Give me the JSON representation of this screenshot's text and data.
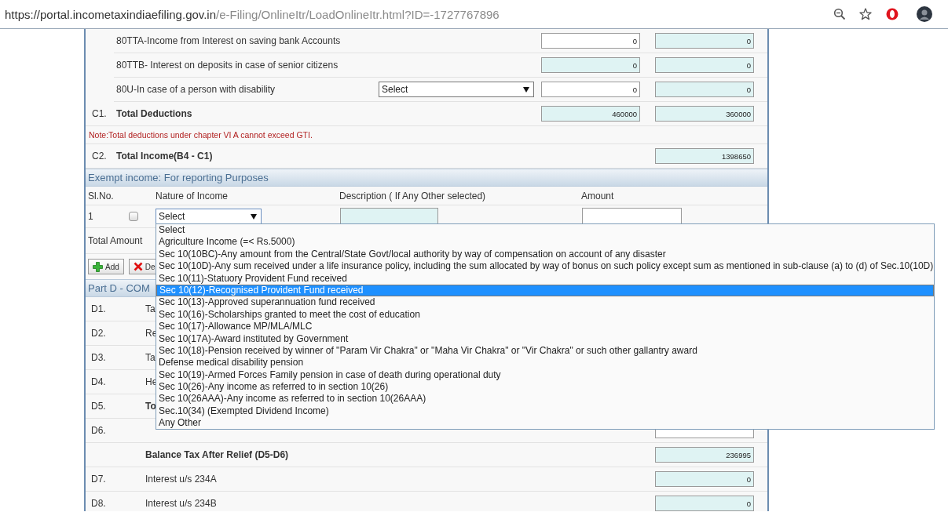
{
  "browser": {
    "url_host": "https://portal.incometaxindiaefiling.gov.in",
    "url_path": "/e-Filing/OnlineItr/LoadOnlineItr.html?ID=-1727767896"
  },
  "deductions": [
    {
      "kind": "item",
      "label": "80TTA-Income from Interest on saving bank Accounts",
      "fields": [
        {
          "value": "0",
          "editable": true
        },
        {
          "value": "0",
          "editable": false
        }
      ]
    },
    {
      "kind": "item",
      "label": "80TTB- Interest on deposits in case of senior citizens",
      "fields": [
        {
          "value": "0",
          "editable": false
        },
        {
          "value": "0",
          "editable": false
        }
      ]
    },
    {
      "kind": "item",
      "label": "80U-In case of a person with disability",
      "select": "Select",
      "fields": [
        {
          "value": "0",
          "editable": true
        },
        {
          "value": "0",
          "editable": false
        }
      ]
    },
    {
      "kind": "total",
      "code": "C1.",
      "label": "Total Deductions",
      "fields": [
        {
          "value": "460000",
          "editable": false
        },
        {
          "value": "360000",
          "editable": false
        }
      ]
    },
    {
      "kind": "note",
      "text": "Note:Total deductions under chapter VI A cannot exceed GTI."
    },
    {
      "kind": "total",
      "code": "C2.",
      "label": "Total Income(B4 - C1)",
      "fields": [
        {
          "value": "1398650",
          "editable": false
        }
      ]
    }
  ],
  "exempt": {
    "title": "Exempt income: For reporting Purposes",
    "columns": [
      "Sl.No.",
      "Nature of Income",
      "Description ( If Any Other selected)",
      "Amount"
    ],
    "rows": [
      {
        "sl": "1",
        "checked": false,
        "nature": "Select"
      }
    ],
    "total_label": "Total Amount",
    "buttons": [
      {
        "label": "Add",
        "kind": "add"
      },
      {
        "label": "De",
        "kind": "delete"
      }
    ],
    "dropdown": [
      {
        "label": "Select",
        "selected": false
      },
      {
        "label": "Agriculture Income (=< Rs.5000)",
        "selected": false
      },
      {
        "label": "Sec 10(10BC)-Any amount from the Central/State Govt/local authority by way of compensation on account of any disaster",
        "selected": false
      },
      {
        "label": "Sec 10(10D)-Any sum received under a life insurance policy, including the sum allocated by way of bonus on such policy except sum as mentioned in sub-clause (a) to (d) of Sec.10(10D)",
        "selected": false
      },
      {
        "label": "Sec 10(11)-Statuory Provident Fund received",
        "selected": false
      },
      {
        "label": "Sec 10(12)-Recognised Provident Fund received",
        "selected": true
      },
      {
        "label": "Sec 10(13)-Approved superannuation fund received",
        "selected": false
      },
      {
        "label": "Sec 10(16)-Scholarships granted to meet the cost of education",
        "selected": false
      },
      {
        "label": "Sec 10(17)-Allowance MP/MLA/MLC",
        "selected": false
      },
      {
        "label": "Sec 10(17A)-Award instituted by Government",
        "selected": false
      },
      {
        "label": "Sec 10(18)-Pension received by winner of \"Param Vir Chakra\" or \"Maha Vir Chakra\" or \"Vir Chakra\" or such other gallantry award",
        "selected": false
      },
      {
        "label": "Defense medical disability pension",
        "selected": false
      },
      {
        "label": "Sec 10(19)-Armed Forces Family pension in case of death during operational duty",
        "selected": false
      },
      {
        "label": "Sec 10(26)-Any income as referred to in section 10(26)",
        "selected": false
      },
      {
        "label": "Sec 10(26AAA)-Any income as referred to in section 10(26AAA)",
        "selected": false
      },
      {
        "label": "Sec.10(34) (Exempted Dividend Income)",
        "selected": false
      },
      {
        "label": "Any Other",
        "selected": false
      }
    ]
  },
  "part_d": {
    "title": "Part D - COM",
    "rows": [
      {
        "code": "D1.",
        "label": "Ta",
        "bold": false
      },
      {
        "code": "D2.",
        "label": "Re",
        "bold": false
      },
      {
        "code": "D3.",
        "label": "Ta",
        "bold": false
      },
      {
        "code": "D4.",
        "label": "He",
        "bold": false
      },
      {
        "code": "D5.",
        "label": "To",
        "bold": true
      },
      {
        "code": "D6.",
        "field": {
          "editable": true
        }
      },
      {
        "label": "Balance Tax After Relief (D5-D6)",
        "bold": true,
        "field": {
          "value": "236995",
          "editable": false
        }
      },
      {
        "code": "D7.",
        "label": "Interest u/s 234A",
        "bold": false,
        "field": {
          "value": "0",
          "editable": false
        }
      },
      {
        "code": "D8.",
        "label": "Interest u/s 234B",
        "bold": false,
        "field": {
          "value": "0",
          "editable": false
        }
      }
    ]
  }
}
